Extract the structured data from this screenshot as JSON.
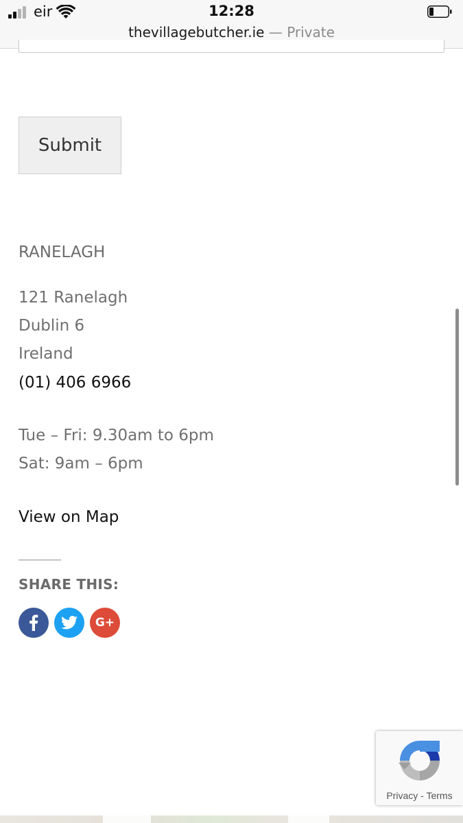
{
  "status_bar": {
    "carrier": "eir",
    "time": "12:28",
    "url": "thevillagebutcher.ie",
    "url_separator": "—",
    "browsing_mode": "Private",
    "icons": [
      "signal-icon",
      "wifi-icon",
      "battery-icon"
    ]
  },
  "form": {
    "submit_label": "Submit"
  },
  "shop": {
    "title": "RANELAGH",
    "address": [
      "121 Ranelagh",
      "Dublin 6",
      "Ireland"
    ],
    "phone": "(01) 406 6966",
    "hours": [
      "Tue – Fri: 9.30am to 6pm",
      "Sat: 9am – 6pm"
    ],
    "map_link": "View on Map"
  },
  "share": {
    "label": "SHARE THIS:",
    "buttons": [
      {
        "icon": "facebook-icon",
        "color": "#3b5998"
      },
      {
        "icon": "twitter-icon",
        "color": "#1da1f2"
      },
      {
        "icon": "google-plus-icon",
        "text": "G+",
        "color": "#dd4b39"
      }
    ]
  },
  "recaptcha": {
    "privacy": "Privacy",
    "separator": "-",
    "terms": "Terms"
  },
  "colors": {
    "text_grey": "#6f6f6f",
    "text_dark": "#111111",
    "button_bg": "#efefef"
  }
}
